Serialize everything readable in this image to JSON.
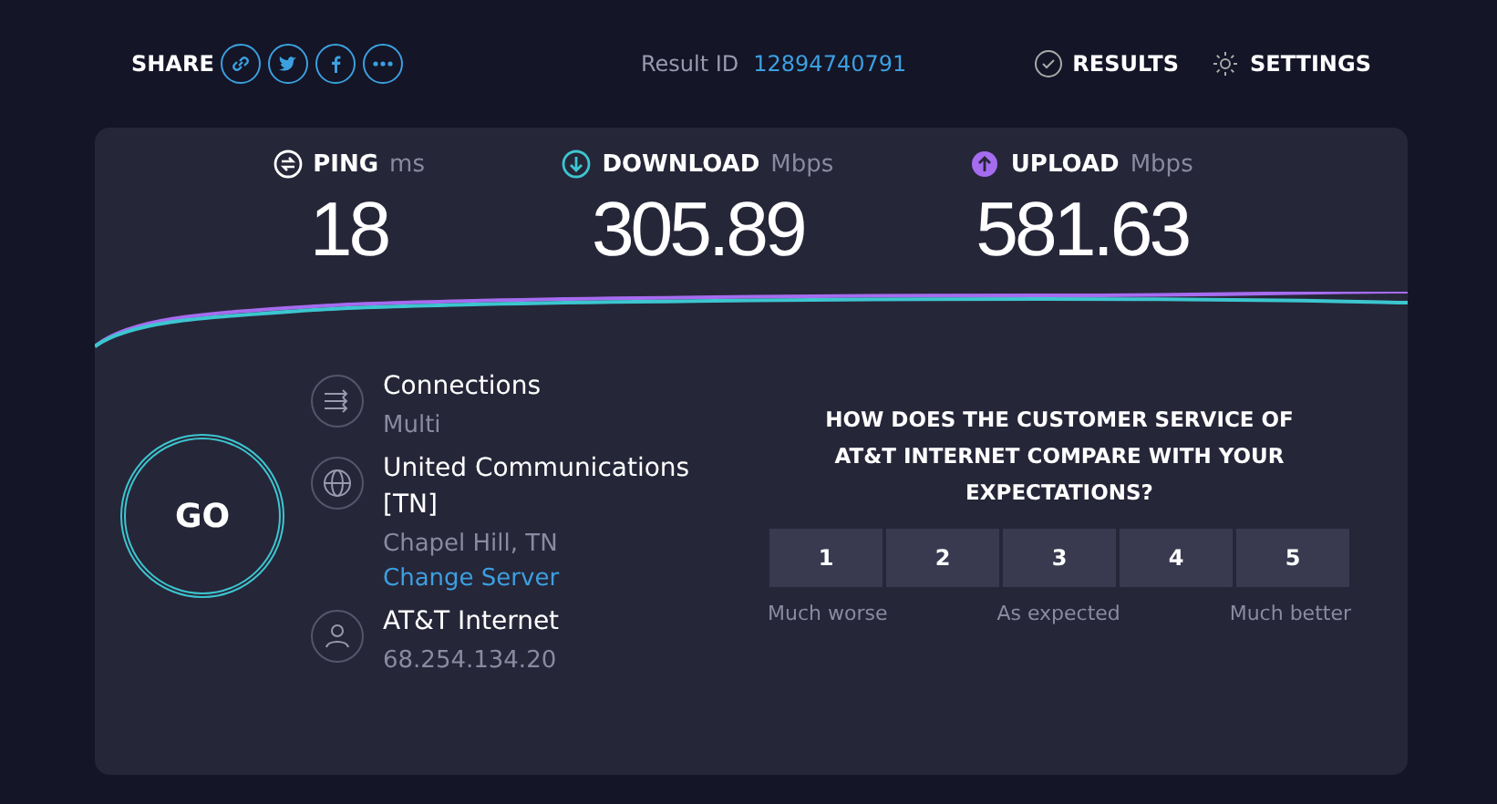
{
  "share": {
    "label": "SHARE",
    "icons": [
      {
        "kind": "link"
      },
      {
        "kind": "twitter"
      },
      {
        "kind": "facebook"
      },
      {
        "kind": "more"
      }
    ]
  },
  "result": {
    "label": "Result ID",
    "id": "12894740791"
  },
  "nav": [
    {
      "kind": "results",
      "label": "RESULTS"
    },
    {
      "kind": "settings",
      "label": "SETTINGS"
    }
  ],
  "metrics": [
    {
      "kind": "ping",
      "label": "PING",
      "unit": "ms",
      "value": "18",
      "color": "#ffffff"
    },
    {
      "kind": "download",
      "label": "DOWNLOAD",
      "unit": "Mbps",
      "value": "305.89",
      "color": "#3cc6cf"
    },
    {
      "kind": "upload",
      "label": "UPLOAD",
      "unit": "Mbps",
      "value": "581.63",
      "color": "#a66cf0"
    }
  ],
  "go": "GO",
  "info": [
    {
      "kind": "connections",
      "title": "Connections",
      "subtitle": "Multi"
    },
    {
      "kind": "server",
      "title": "United Communications [TN]",
      "subtitle": "Chapel Hill, TN",
      "link": "Change Server"
    },
    {
      "kind": "provider",
      "title": "AT&T Internet",
      "subtitle": "68.254.134.20"
    }
  ],
  "survey": {
    "question": "HOW DOES THE CUSTOMER SERVICE OF AT&T INTERNET COMPARE WITH YOUR EXPECTATIONS?",
    "options": [
      {
        "label": "1",
        "selected": false
      },
      {
        "label": "2",
        "selected": false
      },
      {
        "label": "3",
        "selected": false
      },
      {
        "label": "4",
        "selected": false
      },
      {
        "label": "5",
        "selected": false
      }
    ],
    "scale": [
      "Much worse",
      "As expected",
      "Much better"
    ]
  }
}
